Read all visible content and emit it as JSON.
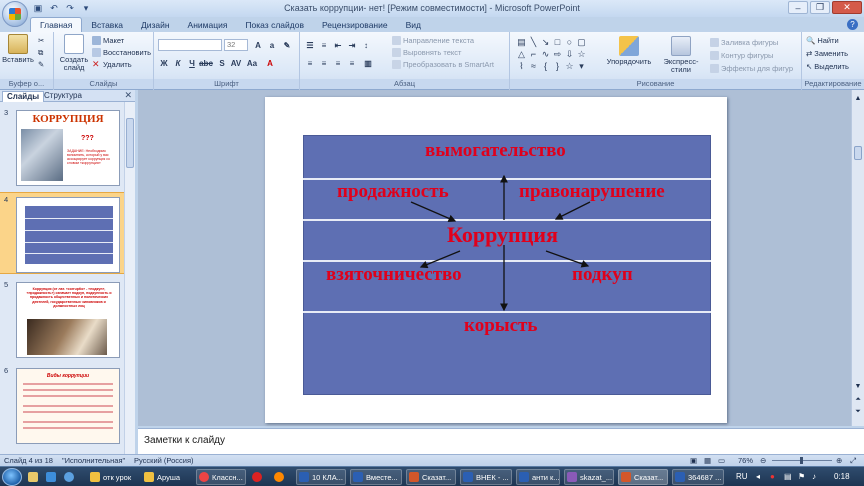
{
  "window": {
    "title": "Сказать коррупции- нет! [Режим совместимости] - Microsoft PowerPoint",
    "controls": [
      "–",
      "❐",
      "✕"
    ]
  },
  "quick_access": [
    "save-icon",
    "undo-icon",
    "redo-icon",
    "customize-icon"
  ],
  "ribbon_tabs": [
    "Главная",
    "Вставка",
    "Дизайн",
    "Анимация",
    "Показ слайдов",
    "Рецензирование",
    "Вид"
  ],
  "ribbon": {
    "clipboard": {
      "paste": "Вставить",
      "label": "Буфер о..."
    },
    "slides": {
      "new_slide": "Создать слайд",
      "layout": "Макет",
      "reset": "Восстановить",
      "delete": "Удалить",
      "label": "Слайды"
    },
    "font": {
      "name_value": "",
      "size_value": "32",
      "label": "Шрифт"
    },
    "paragraph": {
      "text_direction": "Направление текста",
      "align_text": "Выровнять текст",
      "smartart": "Преобразовать в SmartArt",
      "label": "Абзац"
    },
    "drawing": {
      "arrange": "Упорядочить",
      "quick_styles": "Экспресс-стили",
      "fill": "Заливка фигуры",
      "outline": "Контур фигуры",
      "effects": "Эффекты для фигур",
      "label": "Рисование"
    },
    "editing": {
      "find": "Найти",
      "replace": "Заменить",
      "select": "Выделить",
      "label": "Редактирование"
    }
  },
  "pane_tabs": [
    "Слайды",
    "Структура"
  ],
  "thumbnails": [
    {
      "num": "3",
      "title": "КОРРУПЦИЯ",
      "qmarks": "???",
      "caption": "ЗАДАНИЕ: Необходимо вспомнить, который у вас ассоциирует коррупция со словом «коррупция»"
    },
    {
      "num": "4",
      "selected": true
    },
    {
      "num": "5",
      "text": "Коррупция (от лат. «corruptio» - «подкуп», «продажность») означает подкуп, подкупность и продажность общественных и политических деятелей, государственных чиновников и должностных лиц"
    },
    {
      "num": "6",
      "title": "Виды коррупции"
    }
  ],
  "slide": {
    "words": {
      "top": "вымогательство",
      "left_upper": "продажность",
      "right_upper": "правонарушение",
      "center": "Коррупция",
      "left_lower": "взяточничество",
      "right_lower": "подкуп",
      "bottom": "корысть"
    }
  },
  "notes_placeholder": "Заметки к слайду",
  "status": {
    "slide": "Слайд 4 из 18",
    "theme": "\"Исполнительная\"",
    "language": "Русский (Россия)",
    "zoom": "76%"
  },
  "taskbar": {
    "items": [
      "отк урок",
      "Аруша",
      "Классн...",
      "10 КЛА...",
      "Вместе...",
      "Сказат...",
      "ВНЕК - ...",
      "анти к...",
      "skazat_...",
      "Сказат...",
      "364687 ..."
    ],
    "lang": "RU",
    "time": "0:18"
  },
  "colors": {
    "board": "#5e6fb3",
    "word_red": "#e0001b",
    "selected_thumb": "#fbd489"
  }
}
